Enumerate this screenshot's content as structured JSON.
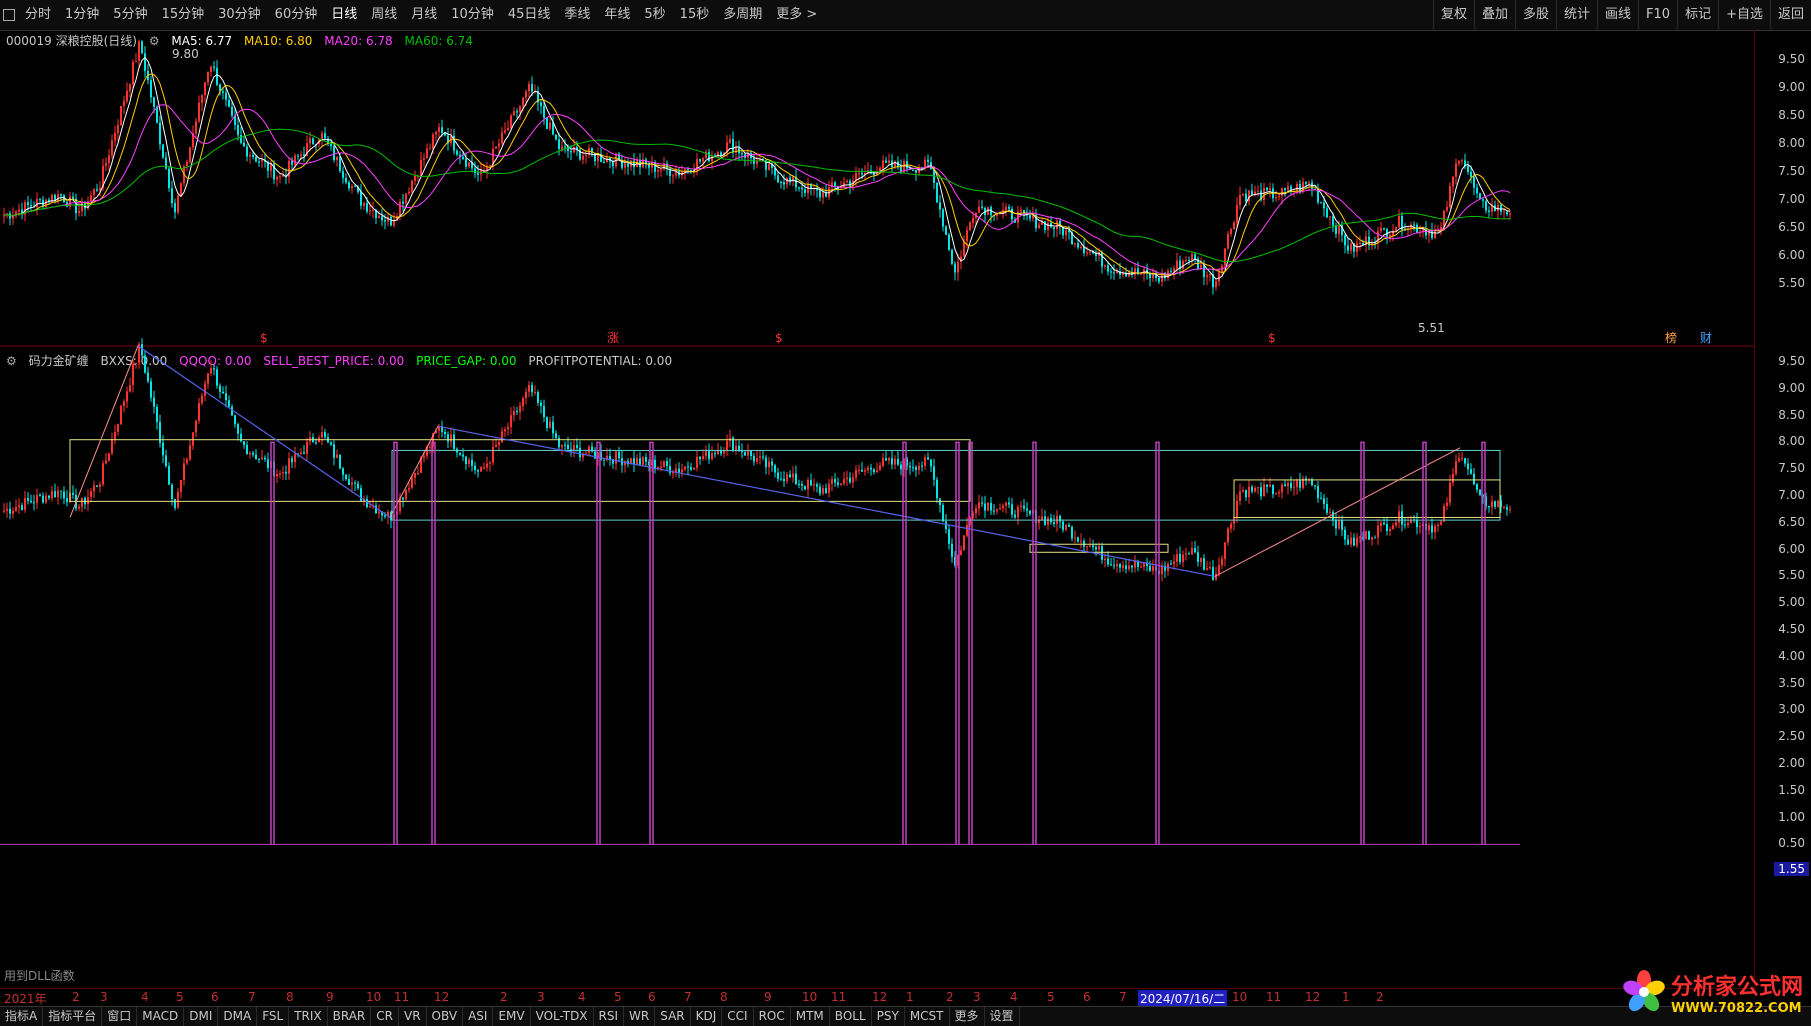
{
  "toolbar": {
    "tabs": [
      "分时",
      "1分钟",
      "5分钟",
      "15分钟",
      "30分钟",
      "60分钟",
      "日线",
      "周线",
      "月线",
      "10分钟",
      "45日线",
      "季线",
      "年线",
      "5秒",
      "15秒",
      "多周期",
      "更多 >"
    ],
    "active_tab": "日线",
    "right_buttons": [
      "复权",
      "叠加",
      "多股",
      "统计",
      "画线",
      "F10",
      "标记",
      "+自选",
      "返回"
    ]
  },
  "main_chart": {
    "stock": "000019 深粮控股(日线)",
    "ma5": "MA5: 6.77",
    "ma10": "MA10: 6.80",
    "ma20": "MA20: 6.78",
    "ma60": "MA60: 6.74",
    "high_label": "9.80",
    "low_label": "5.51",
    "axis_ticks": [
      "9.50",
      "9.00",
      "8.50",
      "8.00",
      "7.50",
      "7.00",
      "6.50",
      "6.00",
      "5.50"
    ],
    "markers": [
      "$",
      "涨",
      "$",
      "$",
      "榜",
      "财"
    ]
  },
  "indicator": {
    "name": "码力金矿缠",
    "bxxs": "BXXS: 0.00",
    "qqqq": "QQQQ: 0.00",
    "sell": "SELL_BEST_PRICE: 0.00",
    "gap": "PRICE_GAP: 0.00",
    "profit": "PROFITPOTENTIAL: 0.00",
    "axis_ticks": [
      "9.50",
      "9.00",
      "8.50",
      "8.00",
      "7.50",
      "7.00",
      "6.50",
      "6.00",
      "5.50",
      "5.00",
      "4.50",
      "4.00",
      "3.50",
      "3.00",
      "2.50",
      "2.00",
      "1.50",
      "1.00",
      "0.50"
    ],
    "current_value": "1.55",
    "dll_note": "用到DLL函数"
  },
  "date_axis": [
    "2021年",
    "2",
    "3",
    "4",
    "5",
    "6",
    "7",
    "8",
    "9",
    "10",
    "11",
    "12",
    "2",
    "3",
    "4",
    "5",
    "6",
    "7",
    "8",
    "9",
    "10",
    "11",
    "12",
    "1",
    "2",
    "3",
    "4",
    "5",
    "6",
    "7",
    "2024/07/16/二",
    "10",
    "11",
    "12",
    "1",
    "2"
  ],
  "bottom_tabs": [
    "指标A",
    "指标平台",
    "窗口",
    "MACD",
    "DMI",
    "DMA",
    "FSL",
    "TRIX",
    "BRAR",
    "CR",
    "VR",
    "OBV",
    "ASI",
    "EMV",
    "VOL-TDX",
    "RSI",
    "WR",
    "SAR",
    "KDJ",
    "CCI",
    "ROC",
    "MTM",
    "BOLL",
    "PSY",
    "MCST",
    "更多",
    "设置"
  ],
  "logo": {
    "name": "分析家公式网",
    "url": "WWW.70822.COM"
  },
  "colors": {
    "up": "#ff3232",
    "down": "#00e6e6",
    "ma5": "#ffffff",
    "ma10": "#ffd000",
    "ma20": "#ff40ff",
    "ma60": "#00c000"
  }
}
